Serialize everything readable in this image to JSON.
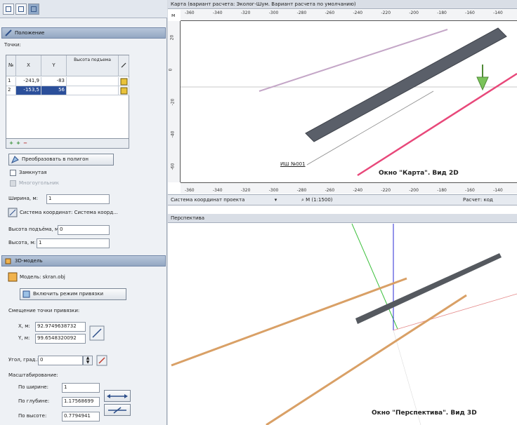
{
  "toolbar": {
    "buttons": [
      "view1",
      "view2",
      "view3"
    ]
  },
  "position_panel": {
    "header": "Положение",
    "points_label": "Точки:",
    "columns": [
      "№",
      "X",
      "Y",
      "Высота подъема"
    ],
    "rows": [
      {
        "n": "1",
        "x": "-241,9",
        "y": "-83"
      },
      {
        "n": "2",
        "x": "-153,5",
        "y": "56"
      }
    ],
    "convert_button": "Преобразовать в полигон",
    "closed_label": "Замкнутая",
    "disabled_label": "Многоугольник",
    "width_label": "Ширина, м:",
    "width_value": "1",
    "coord_system_label": "Система координат: Система коорд...",
    "lift_height_label": "Высота подъёма, м:",
    "lift_height_value": "0",
    "height_label": "Высота, м:",
    "height_value": "1"
  },
  "model_panel": {
    "header": "3D-модель",
    "model_label": "Модель: skran.obj",
    "snap_button": "Включить режим привязки",
    "offset_label": "Смещение точки привязки:",
    "x_label": "X, м:",
    "x_value": "92.9749638732",
    "y_label": "Y, м:",
    "y_value": "99.6548320092",
    "angle_label": "Угол, град.:",
    "angle_value": "0",
    "scale_label": "Масштабирование:",
    "scale_width_label": "По ширине:",
    "scale_width_value": "1",
    "scale_depth_label": "По глубине:",
    "scale_depth_value": "1.17568699",
    "scale_height_label": "По высоте:",
    "scale_height_value": "0.7794941"
  },
  "map_window": {
    "title": "Карта (вариант расчета: Эколог-Шум. Вариант расчета по умолчанию)",
    "top_ticks": [
      "-360",
      "-340",
      "-320",
      "-300",
      "-280",
      "-260",
      "-240",
      "-220",
      "-200",
      "-180",
      "-160",
      "-140"
    ],
    "left_ticks": [
      "20",
      "0",
      "-20",
      "-40",
      "-60"
    ],
    "label_ish": "ИШ №001",
    "caption": "Окно \"Карта\". Вид 2D",
    "status_coord": "Система координат проекта",
    "status_scale": "М (1:1500)",
    "status_calc": "Расчет: код"
  },
  "perspective_window": {
    "title": "Перспектива",
    "caption": "Окно \"Перспектива\". Вид 3D"
  },
  "colors": {
    "panel_header": "#93a7c2",
    "selection": "#2b4f9a",
    "pink_line": "#e8487a",
    "gray_bar": "#5a5f69",
    "orange_line": "#d9a066",
    "arrow_green": "#7ac35a"
  }
}
